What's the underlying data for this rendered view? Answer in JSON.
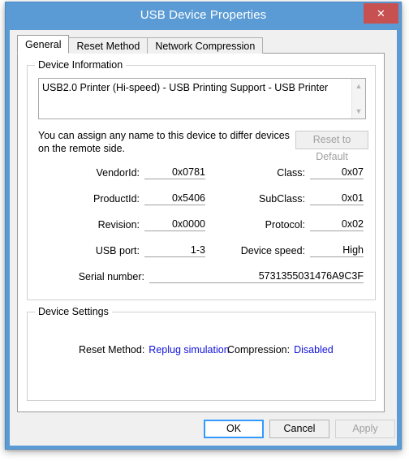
{
  "window": {
    "title": "USB Device Properties",
    "close_label": "✕",
    "accent_color": "#5b9bd5",
    "close_color": "#c75050"
  },
  "tabs": [
    {
      "label": "General",
      "active": true
    },
    {
      "label": "Reset Method",
      "active": false
    },
    {
      "label": "Network Compression",
      "active": false
    }
  ],
  "device_information": {
    "group_title": "Device Information",
    "description": "USB2.0 Printer (Hi-speed) - USB Printing Support - USB Printer",
    "scroll_up_icon": "▲",
    "scroll_down_icon": "▼",
    "hint": "You can assign any name to this device to differ devices on the remote side.",
    "reset_button": "Reset to Default",
    "fields_left": [
      {
        "label": "VendorId:",
        "value": "0x0781"
      },
      {
        "label": "ProductId:",
        "value": "0x5406"
      },
      {
        "label": "Revision:",
        "value": "0x0000"
      },
      {
        "label": "USB port:",
        "value": "1-3"
      }
    ],
    "fields_right": [
      {
        "label": "Class:",
        "value": "0x07"
      },
      {
        "label": "SubClass:",
        "value": "0x01"
      },
      {
        "label": "Protocol:",
        "value": "0x02"
      },
      {
        "label": "Device speed:",
        "value": "High"
      }
    ],
    "serial": {
      "label": "Serial number:",
      "value": "5731355031476A9C3F"
    }
  },
  "device_settings": {
    "group_title": "Device Settings",
    "reset_method": {
      "label": "Reset Method:",
      "value": "Replug simulation"
    },
    "compression": {
      "label": "Compression:",
      "value": "Disabled"
    },
    "link_color": "#1111dd"
  },
  "footer": {
    "ok": "OK",
    "cancel": "Cancel",
    "apply": "Apply"
  }
}
